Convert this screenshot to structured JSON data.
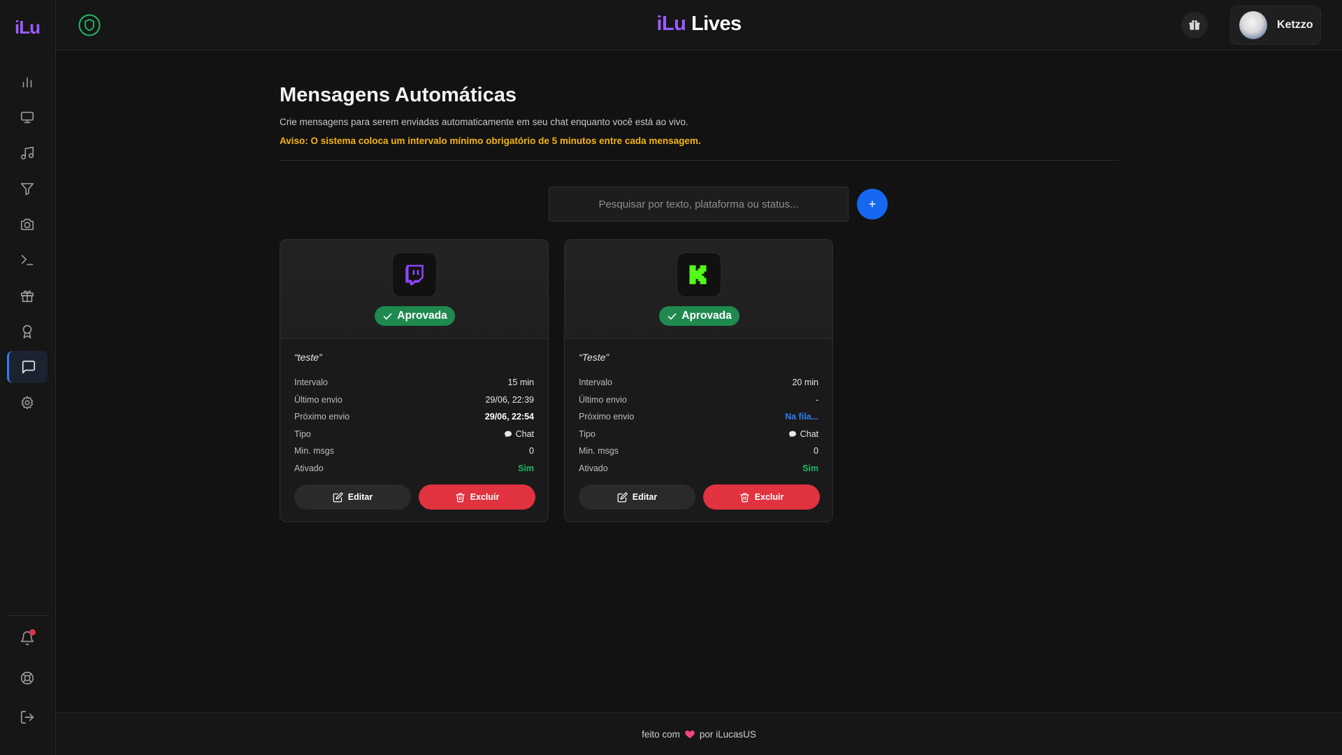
{
  "sidebar": {
    "logo": "iLu",
    "items": [
      {
        "icon": "bar-chart-icon"
      },
      {
        "icon": "monitor-icon"
      },
      {
        "icon": "music-note-icon"
      },
      {
        "icon": "filter-icon"
      },
      {
        "icon": "camera-icon"
      },
      {
        "icon": "terminal-icon"
      },
      {
        "icon": "gift-icon"
      },
      {
        "icon": "award-icon"
      },
      {
        "icon": "message-square-icon",
        "active": true
      },
      {
        "icon": "gear-icon"
      }
    ],
    "bottom_items": [
      {
        "icon": "bell-icon",
        "notification": true
      },
      {
        "icon": "lifebuoy-icon"
      },
      {
        "icon": "logout-icon"
      }
    ]
  },
  "header": {
    "brand_ilu": "iLu",
    "brand_lives": "Lives",
    "user": {
      "name": "Ketzzo"
    }
  },
  "page": {
    "title": "Mensagens Automáticas",
    "subtitle": "Crie mensagens para serem enviadas automaticamente em seu chat enquanto você está ao vivo.",
    "warning": "Aviso: O sistema coloca um intervalo mínimo obrigatório de 5 minutos entre cada mensagem."
  },
  "search": {
    "placeholder": "Pesquisar por texto, plataforma ou status..."
  },
  "add_button": {
    "label": "+"
  },
  "cards": [
    {
      "platform_icon": "twitch-icon",
      "status": "Aprovada",
      "message": "“teste”",
      "rows": [
        {
          "label": "Intervalo",
          "value": "15 min"
        },
        {
          "label": "Último envio",
          "value": "29/06, 22:39"
        },
        {
          "label": "Próximo envio",
          "value": "29/06, 22:54"
        },
        {
          "label": "Tipo",
          "value": "Chat"
        },
        {
          "label": "Min. msgs",
          "value": "0"
        },
        {
          "label": "Ativado",
          "value": "Sim"
        }
      ],
      "edit_label": "Editar",
      "delete_label": "Excluir"
    },
    {
      "platform_icon": "kick-icon",
      "status": "Aprovada",
      "message": "“Teste”",
      "rows": [
        {
          "label": "Intervalo",
          "value": "20 min"
        },
        {
          "label": "Último envio",
          "value": "-"
        },
        {
          "label": "Próximo envio",
          "value": "Na fila..."
        },
        {
          "label": "Tipo",
          "value": "Chat"
        },
        {
          "label": "Min. msgs",
          "value": "0"
        },
        {
          "label": "Ativado",
          "value": "Sim"
        }
      ],
      "edit_label": "Editar",
      "delete_label": "Excluir"
    }
  ],
  "footer": {
    "prefix": "feito com",
    "suffix": "por iLucasUS"
  },
  "colors": {
    "accent_purple": "#9b5cff",
    "primary_blue": "#1668f0",
    "success_green": "#1e8a4f",
    "danger_red": "#e0323f",
    "warning_yellow": "#f5b40f",
    "twitch_purple": "#9146ff",
    "kick_green": "#53fc18"
  }
}
